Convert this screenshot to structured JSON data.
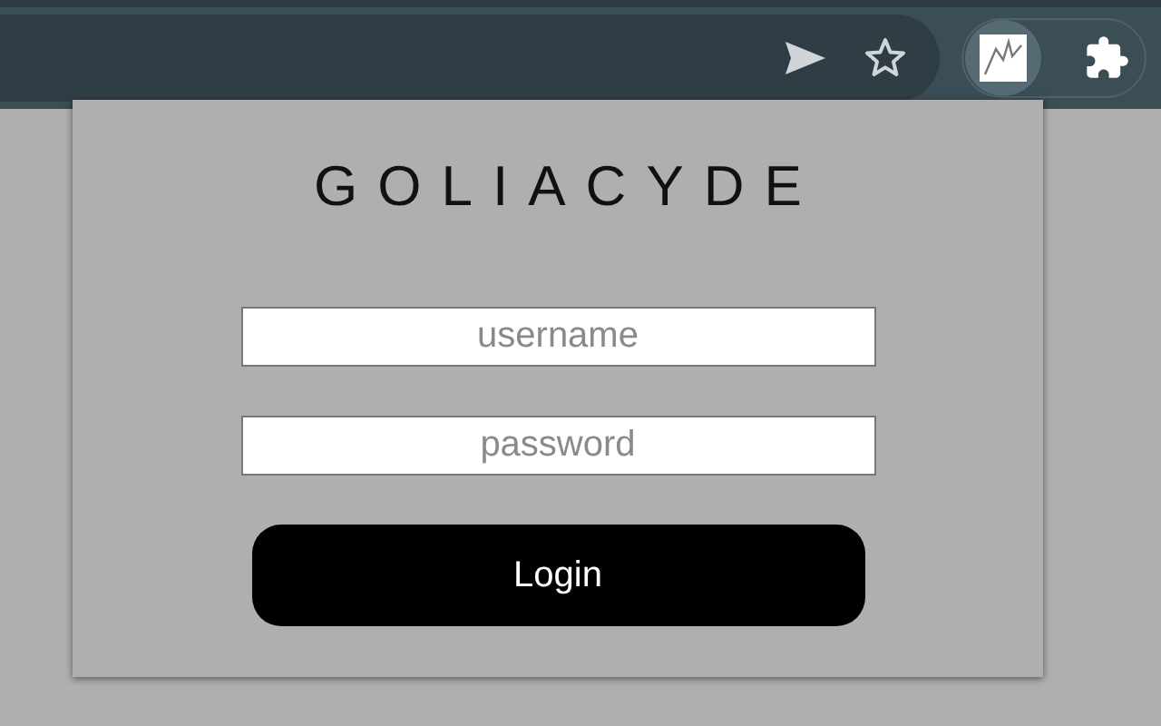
{
  "popup": {
    "title": "GOLIACYDE",
    "fields": [
      {
        "placeholder": "username"
      },
      {
        "placeholder": "password"
      }
    ],
    "button": "Login"
  }
}
